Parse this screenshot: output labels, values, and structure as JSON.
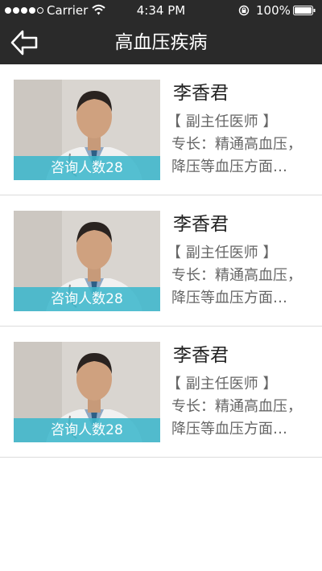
{
  "status_bar": {
    "carrier": "Carrier",
    "time": "4:34 PM",
    "battery": "100%"
  },
  "nav": {
    "title": "高血压疾病",
    "back_icon": "back-arrow-icon"
  },
  "doctors": [
    {
      "name": "李香君",
      "title": "【 副主任医师 】",
      "specialty_line1": "专长：精通高血压，",
      "specialty_line2": "降压等血压方面…",
      "consult_label": "咨询人数28"
    },
    {
      "name": "李香君",
      "title": "【 副主任医师 】",
      "specialty_line1": "专长：精通高血压，",
      "specialty_line2": "降压等血压方面…",
      "consult_label": "咨询人数28"
    },
    {
      "name": "李香君",
      "title": "【 副主任医师 】",
      "specialty_line1": "专长：精通高血压，",
      "specialty_line2": "降压等血压方面…",
      "consult_label": "咨询人数28"
    }
  ],
  "colors": {
    "header_bg": "#2a2a2a",
    "accent": "#3db7cc",
    "divider": "#dcdcdc",
    "secondary_text": "#666666"
  }
}
